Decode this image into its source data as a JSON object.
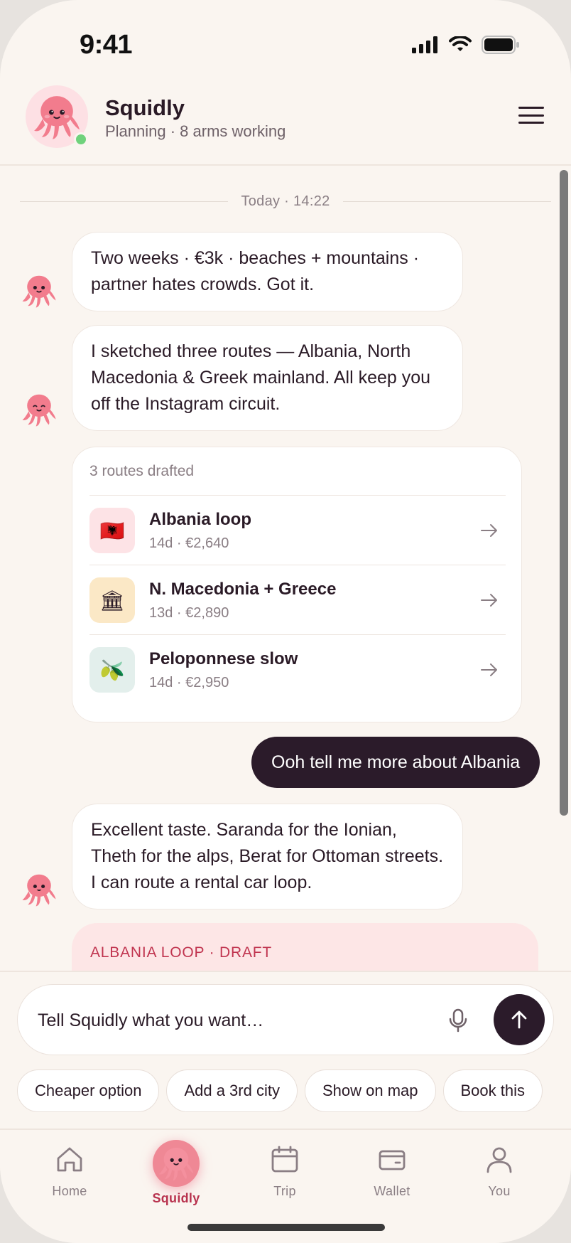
{
  "status_bar": {
    "time": "9:41"
  },
  "header": {
    "title": "Squidly",
    "subtitle": "Planning · 8 arms working"
  },
  "chat": {
    "date_divider": "Today · 14:22",
    "messages": [
      {
        "from": "bot",
        "text": "Two weeks · €3k · beaches + mountains · partner hates crowds. Got it."
      },
      {
        "from": "bot",
        "text": "I sketched three routes — Albania, North Macedonia & Greek mainland. All keep you off the Instagram circuit."
      },
      {
        "from": "user",
        "text": "Ooh tell me more about Albania"
      },
      {
        "from": "bot",
        "text": "Excellent taste. Saranda for the Ionian, Theth for the alps, Berat for Ottoman streets. I can route a rental car loop."
      }
    ],
    "routes_card": {
      "heading": "3 routes drafted",
      "routes": [
        {
          "name": "Albania loop",
          "meta": "14d · €2,640",
          "icon": "albania-flag-icon",
          "emoji": "🇦🇱"
        },
        {
          "name": "N. Macedonia + Greece",
          "meta": "13d · €2,890",
          "icon": "classical-building-icon",
          "emoji": "🏛"
        },
        {
          "name": "Peloponnese slow",
          "meta": "14d · €2,950",
          "icon": "olive-icon",
          "emoji": "🫒"
        }
      ]
    },
    "draft_card": {
      "label": "ALBANIA LOOP · DRAFT"
    }
  },
  "composer": {
    "placeholder": "Tell Squidly what you want…",
    "chips": [
      "Cheaper option",
      "Add a 3rd city",
      "Show on map",
      "Book this"
    ]
  },
  "tab_bar": {
    "tabs": [
      {
        "label": "Home",
        "icon": "home-icon"
      },
      {
        "label": "Squidly",
        "icon": "squid-avatar-icon",
        "active": true
      },
      {
        "label": "Trip",
        "icon": "calendar-icon"
      },
      {
        "label": "Wallet",
        "icon": "wallet-icon"
      },
      {
        "label": "You",
        "icon": "person-icon"
      }
    ]
  },
  "colors": {
    "background": "#faf5f0",
    "accent": "#b8324e",
    "user_bubble": "#2b1b2a",
    "octopus": "#f27c8d",
    "online": "#6fd27c"
  }
}
